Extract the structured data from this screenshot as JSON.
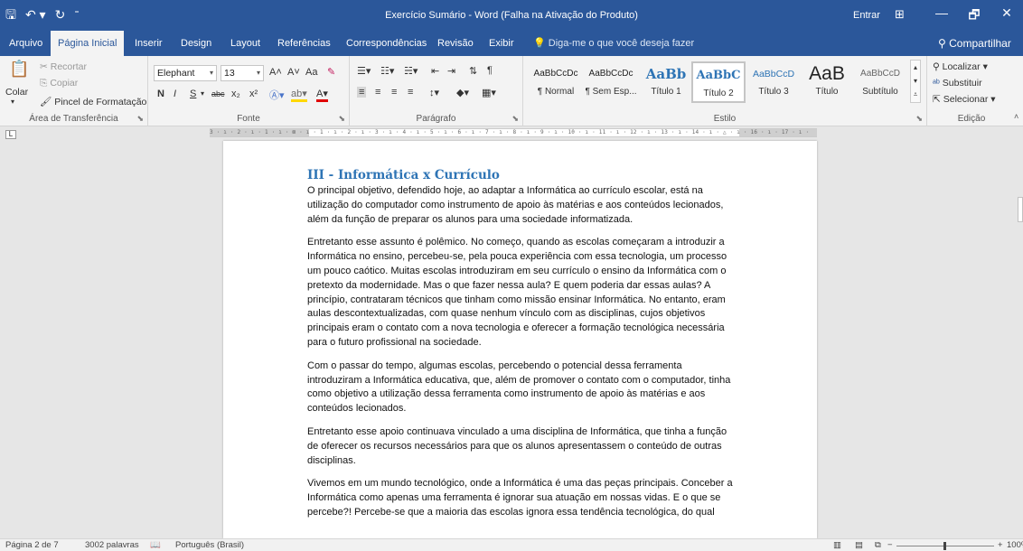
{
  "titlebar": {
    "title": "Exercício Sumário  -  Word (Falha na Ativação do Produto)",
    "signin": "Entrar",
    "qat": {
      "save_icon": "floppy-disk-icon",
      "undo_icon": "undo-icon",
      "redo_icon": "redo-icon",
      "customize_icon": "customize-qat-icon"
    },
    "window": {
      "minimize": "—",
      "restore": "🗗",
      "close": "✕"
    }
  },
  "tabs": [
    "Arquivo",
    "Página Inicial",
    "Inserir",
    "Design",
    "Layout",
    "Referências",
    "Correspondências",
    "Revisão",
    "Exibir"
  ],
  "active_tab": "Página Inicial",
  "tellme": "Diga-me o que você deseja fazer",
  "share": "Compartilhar",
  "ribbon": {
    "clipboard": {
      "label": "Área de Transferência",
      "paste": "Colar",
      "cut": "Recortar",
      "copy": "Copiar",
      "format_painter": "Pincel de Formatação"
    },
    "font": {
      "label": "Fonte",
      "font_name": "Elephant",
      "font_size": "13",
      "bold": "N",
      "italic": "I",
      "underline": "S",
      "strike": "abc",
      "subscript": "x₂",
      "superscript": "x²",
      "grow": "A˄",
      "shrink": "A˅",
      "case": "Aa"
    },
    "paragraph": {
      "label": "Parágrafo"
    },
    "styles": {
      "label": "Estilo",
      "items": [
        {
          "preview": "AaBbCcDc",
          "name": "¶ Normal"
        },
        {
          "preview": "AaBbCcDc",
          "name": "¶ Sem Esp..."
        },
        {
          "preview": "AaBb",
          "name": "Título 1"
        },
        {
          "preview": "AaBbC",
          "name": "Título 2"
        },
        {
          "preview": "AaBbCcD",
          "name": "Título 3"
        },
        {
          "preview": "AaB",
          "name": "Título"
        },
        {
          "preview": "AaBbCcD",
          "name": "Subtítulo"
        }
      ],
      "selected": "Título 2"
    },
    "editing": {
      "label": "Edição",
      "find": "Localizar",
      "replace": "Substituir",
      "select": "Selecionar"
    }
  },
  "ruler": {
    "ticks": "3 · ı · 2 · ı · 1 · ı · ⊠ · ı · 1 · ı · 2 · ı · 3 · ı · 4 · ı · 5 · ı · 6 · ı · 7 · ı · 8 · ı · 9 · ı · 10 · ı · 11 · ı · 12 · ı · 13 · ı · 14 · ı · △ · ı · 16 · ı · 17 · ı ·"
  },
  "document": {
    "heading": "III - Informática x Currículo",
    "paragraphs": [
      "O principal objetivo, defendido hoje, ao adaptar a Informática ao currículo escolar, está na utilização do computador como instrumento de apoio às matérias e aos conteúdos lecionados, além da função de preparar os alunos para uma sociedade informatizada.",
      "Entretanto esse assunto é polêmico. No começo, quando as escolas começaram a introduzir a Informática no ensino, percebeu-se, pela pouca experiência com essa tecnologia, um processo um pouco caótico. Muitas escolas introduziram em seu currículo o ensino da Informática com o pretexto da modernidade. Mas o que fazer nessa aula? E quem poderia dar essas aulas? A princípio, contrataram técnicos que tinham como missão ensinar Informática. No entanto, eram aulas descontextualizadas, com quase nenhum vínculo com as disciplinas, cujos objetivos principais eram o contato com a nova tecnologia e oferecer a formação tecnológica necessária para o futuro profissional na sociedade.",
      "Com o passar do tempo, algumas escolas, percebendo o potencial dessa ferramenta introduziram a Informática educativa, que, além de promover o contato com o computador, tinha como objetivo a utilização dessa ferramenta como instrumento de apoio às matérias e aos conteúdos lecionados.",
      "Entretanto esse apoio continuava vinculado a uma disciplina de Informática, que tinha a função de oferecer os recursos necessários para que os alunos apresentassem o conteúdo de outras disciplinas.",
      "Vivemos em um mundo tecnológico, onde a Informática é uma das peças principais. Conceber a Informática como apenas uma ferramenta é ignorar sua atuação em nossas vidas. E o que se percebe?! Percebe-se que a maioria das escolas ignora essa tendência tecnológica, do qual"
    ]
  },
  "statusbar": {
    "page": "Página 2 de 7",
    "words": "3002 palavras",
    "language": "Português (Brasil)",
    "zoom": "100%",
    "zoom_percent": 100
  },
  "colors": {
    "brand": "#2b579a",
    "heading": "#2e74b5"
  }
}
